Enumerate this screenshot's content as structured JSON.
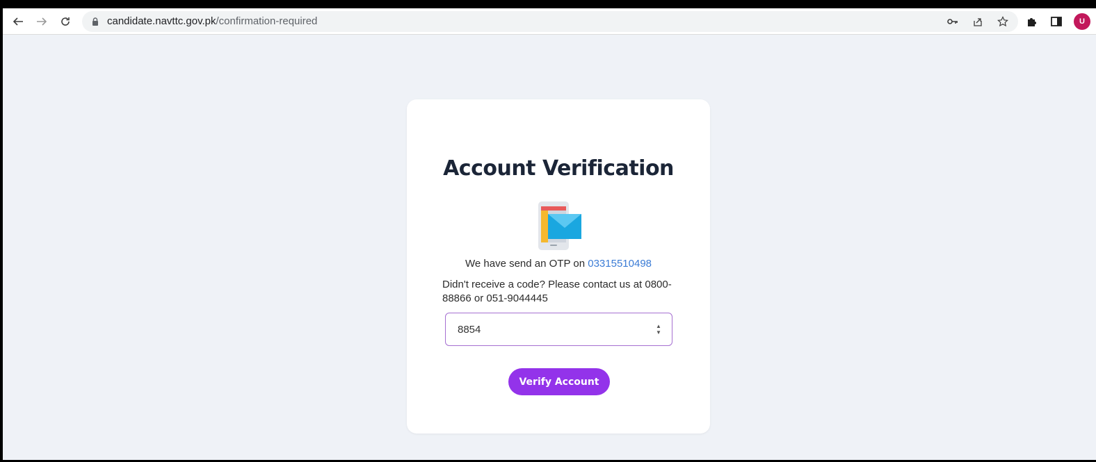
{
  "browser": {
    "url_host": "candidate.navttc.gov.pk",
    "url_path": "/confirmation-required",
    "avatar_letter": "U",
    "colors": {
      "avatar": "#c2185b"
    },
    "icons": {
      "back": "arrow-left-icon",
      "forward": "arrow-right-icon",
      "reload": "reload-icon",
      "lock": "lock-icon",
      "key": "key-icon",
      "share": "share-icon",
      "bookmark": "star-icon",
      "extensions": "puzzle-icon",
      "side_panel": "side-panel-icon"
    }
  },
  "card": {
    "title": "Account Verification",
    "illustration": "phone-message-icon",
    "otp_text": "We have send an OTP on ",
    "phone": "03315510498",
    "help_text": "Didn't receive a code? Please contact us at 0800-88866 or 051-9044445",
    "otp_value": "8854",
    "verify_label": "Verify Account",
    "colors": {
      "accent": "#9333ea",
      "link": "#3a7bd5",
      "input_border": "#a56fd1",
      "title": "#1b2537"
    }
  }
}
